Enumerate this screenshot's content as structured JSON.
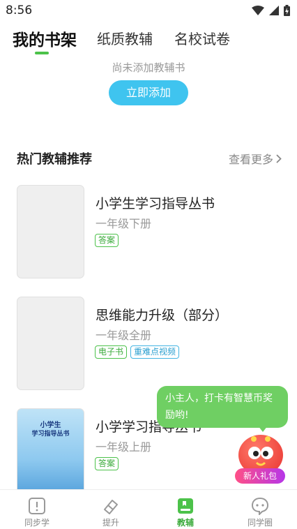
{
  "status_bar": {
    "time": "8:56"
  },
  "top_tabs": [
    {
      "label": "我的书架",
      "active": true
    },
    {
      "label": "纸质教辅",
      "active": false
    },
    {
      "label": "名校试卷",
      "active": false
    }
  ],
  "shelf": {
    "empty_text": "尚未添加教辅书",
    "add_button": "立即添加"
  },
  "section": {
    "title": "热门教辅推荐",
    "more": "查看更多"
  },
  "books": [
    {
      "title": "小学生学习指导丛书",
      "subtitle": "一年级下册",
      "tags": [
        "答案"
      ]
    },
    {
      "title": "思维能力升级（部分）",
      "subtitle": "一年级全册",
      "tags": [
        "电子书",
        "重难点视频"
      ]
    },
    {
      "title": "小学学习指导丛书",
      "subtitle": "一年级上册",
      "tags": [
        "答案"
      ],
      "cover": {
        "line1": "小学生",
        "line2": "学习指导丛书"
      }
    }
  ],
  "promo": {
    "bubble_text": "小主人，打卡有智慧币奖励哟!",
    "gift_label": "新人礼包"
  },
  "bottom_nav": [
    {
      "label": "同步学",
      "icon": "book-alert-icon",
      "active": false
    },
    {
      "label": "提升",
      "icon": "eraser-icon",
      "active": false
    },
    {
      "label": "教辅",
      "icon": "bookmark-book-icon",
      "active": true
    },
    {
      "label": "同学圈",
      "icon": "chat-face-icon",
      "active": false
    }
  ],
  "colors": {
    "accent_green": "#4cc24a",
    "button_blue": "#3fc4ef",
    "bubble_green": "#6fcf63"
  }
}
